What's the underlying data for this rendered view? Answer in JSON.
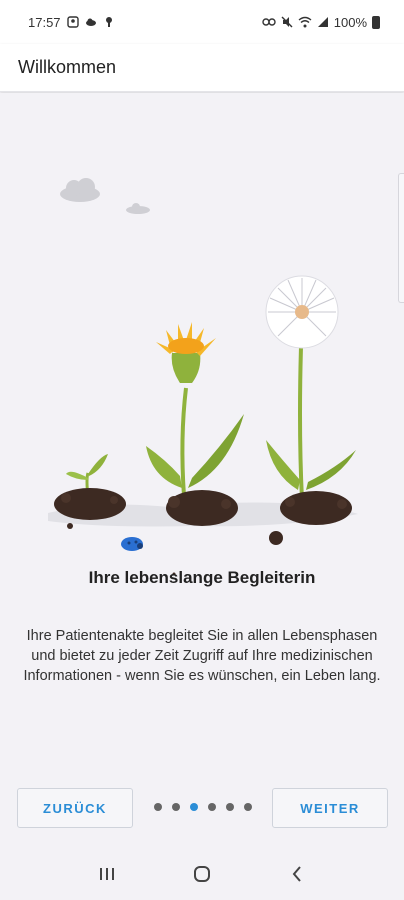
{
  "status_bar": {
    "time": "17:57",
    "battery": "100%",
    "icons_left": [
      "notification-icon",
      "cloud-icon",
      "location-icon"
    ],
    "icons_right": [
      "link-icon",
      "mute-icon",
      "wifi-icon",
      "signal-icon",
      "battery-icon"
    ]
  },
  "app_bar": {
    "title": "Willkommen"
  },
  "slide": {
    "heading": "Ihre lebenslange Begleiterin",
    "body": "Ihre Patientenakte begleitet Sie in allen Lebensphasen und bietet zu jeder Zeit Zugriff auf Ihre medizinischen Informationen - wenn Sie es wünschen, ein Leben lang."
  },
  "pager": {
    "back_label": "ZURÜCK",
    "next_label": "WEITER",
    "total_pages": 6,
    "current_page": 3
  },
  "colors": {
    "accent": "#2b8dd6",
    "background": "#f3f2f6",
    "flower": "#f5b82a",
    "leaf": "#8fb23c",
    "soil": "#3d2a22"
  }
}
